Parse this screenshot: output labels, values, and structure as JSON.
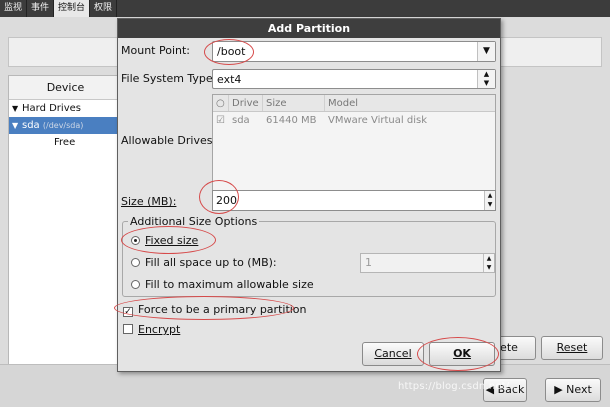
{
  "top_tabs": [
    "监视",
    "事件",
    "控制台",
    "权限"
  ],
  "device_list": {
    "header": "Device",
    "items": [
      {
        "label": "Hard Drives",
        "sub": ""
      },
      {
        "label": "sda",
        "sub": "(/dev/sda)"
      },
      {
        "label": "Free",
        "sub": ""
      }
    ]
  },
  "background_buttons": {
    "delete_partial": "lete",
    "reset": "Reset",
    "back": "Back",
    "next": "Next"
  },
  "watermark": "https://blog.csdn.net/...",
  "dialog": {
    "title": "Add Partition",
    "mount_point_label": "Mount Point:",
    "mount_point_value": "/boot",
    "fs_type_label": "File System Type:",
    "fs_type_value": "ext4",
    "allowable_drives_label": "Allowable Drives:",
    "drives_columns": [
      "Drive",
      "Size",
      "Model"
    ],
    "drives_rows": [
      {
        "checked": true,
        "drive": "sda",
        "size": "61440 MB",
        "model": "VMware Virtual disk"
      }
    ],
    "size_label": "Size (MB):",
    "size_value": "200",
    "additional_size_title": "Additional Size Options",
    "option_fixed": "Fixed size",
    "option_fill_up": "Fill all space up to (MB):",
    "fill_up_value": "1",
    "option_fill_max": "Fill to maximum allowable size",
    "force_primary_label": "Force to be a primary partition",
    "force_primary_checked": true,
    "encrypt_label": "Encrypt",
    "encrypt_checked": false,
    "cancel_label": "Cancel",
    "ok_label": "OK"
  },
  "colors": {
    "title_bar": "#3e3e3e",
    "selection": "#4a7fc1",
    "annotation": "#d64a4a"
  }
}
